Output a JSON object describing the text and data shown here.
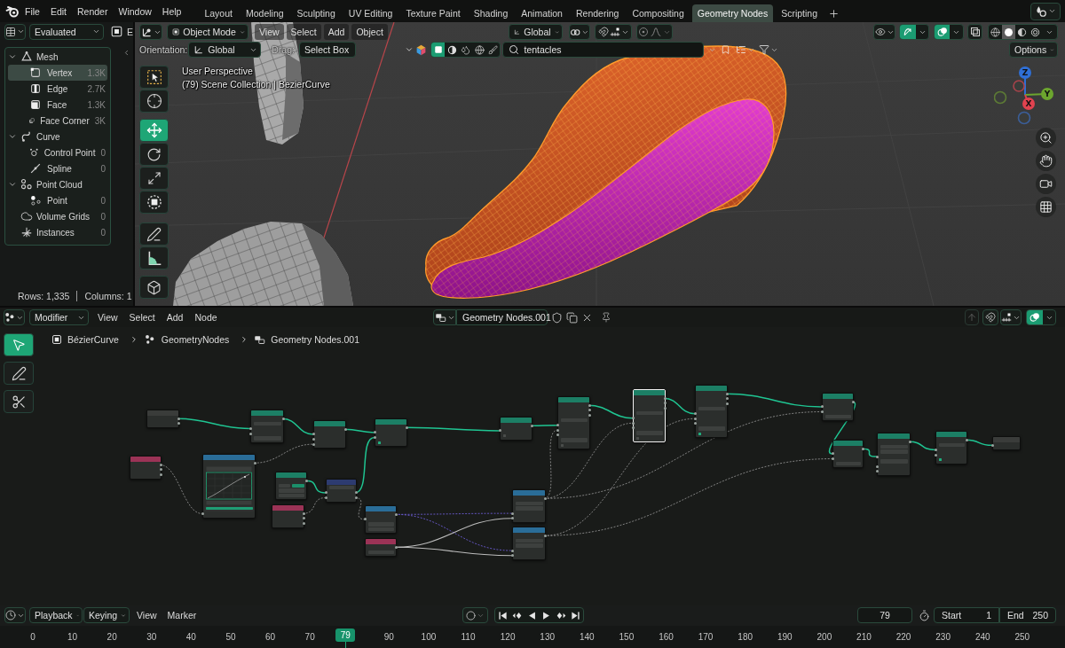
{
  "topbar": {
    "menus": [
      "File",
      "Edit",
      "Render",
      "Window",
      "Help"
    ],
    "workspaces": [
      {
        "label": "Layout",
        "selected": false
      },
      {
        "label": "Modeling",
        "selected": false
      },
      {
        "label": "Sculpting",
        "selected": false
      },
      {
        "label": "UV Editing",
        "selected": false
      },
      {
        "label": "Texture Paint",
        "selected": false
      },
      {
        "label": "Shading",
        "selected": false
      },
      {
        "label": "Animation",
        "selected": false
      },
      {
        "label": "Rendering",
        "selected": false
      },
      {
        "label": "Compositing",
        "selected": false
      },
      {
        "label": "Geometry Nodes",
        "selected": true
      },
      {
        "label": "Scripting",
        "selected": false
      }
    ]
  },
  "spreadsheet": {
    "evaluation": "Evaluated",
    "cut_label": "E",
    "tree": [
      {
        "label": "Mesh",
        "kind": "mesh",
        "expanded": true,
        "selected": false,
        "children": [
          {
            "label": "Vertex",
            "kind": "vertex",
            "count": "1.3K",
            "selected": true
          },
          {
            "label": "Edge",
            "kind": "edge",
            "count": "2.7K",
            "selected": false
          },
          {
            "label": "Face",
            "kind": "face",
            "count": "1.3K",
            "selected": false
          },
          {
            "label": "Face Corner",
            "kind": "corner",
            "count": "3K",
            "selected": false
          }
        ]
      },
      {
        "label": "Curve",
        "kind": "curve",
        "expanded": true,
        "selected": false,
        "children": [
          {
            "label": "Control Point",
            "kind": "control-point",
            "count": "0",
            "selected": false
          },
          {
            "label": "Spline",
            "kind": "spline",
            "count": "0",
            "selected": false
          }
        ]
      },
      {
        "label": "Point Cloud",
        "kind": "pointcloud",
        "expanded": true,
        "selected": false,
        "children": [
          {
            "label": "Point",
            "kind": "point",
            "count": "0",
            "selected": false
          }
        ]
      },
      {
        "label": "Volume Grids",
        "kind": "volume",
        "count": "0",
        "selected": false
      },
      {
        "label": "Instances",
        "kind": "instances",
        "count": "0",
        "selected": false
      }
    ],
    "rows": "Rows: 1,335",
    "columns": "Columns: 1"
  },
  "viewport": {
    "mode": "Object Mode",
    "menus": [
      "View",
      "Select",
      "Add",
      "Object"
    ],
    "transform_orientation": "Global",
    "gizmos_on": true,
    "overlays_on": true,
    "shading": [
      {
        "kind": "wireframe",
        "selected": false
      },
      {
        "kind": "solid",
        "selected": true
      },
      {
        "kind": "material",
        "selected": false
      },
      {
        "kind": "rendered",
        "selected": false
      }
    ],
    "orientation_label": "Orientation:",
    "orientation": "Global",
    "drag_label": "Drag:",
    "drag": "Select Box",
    "filters": [
      {
        "kind": "square",
        "selected": true
      },
      {
        "kind": "halfdisc",
        "selected": false
      },
      {
        "kind": "drops",
        "selected": false
      },
      {
        "kind": "globe",
        "selected": false
      },
      {
        "kind": "brush",
        "selected": false
      }
    ],
    "search": {
      "value": "tentacles"
    },
    "options": "Options",
    "info": [
      "User Perspective",
      "(79) Scene Collection | BezierCurve"
    ],
    "tools": [
      {
        "kind": "select",
        "selected": false
      },
      {
        "kind": "cursor",
        "selected": false
      },
      {
        "kind": "move",
        "selected": true
      },
      {
        "kind": "rotate",
        "selected": false
      },
      {
        "kind": "scale",
        "selected": false
      },
      {
        "kind": "transform",
        "selected": false
      },
      {
        "kind": "annotate",
        "selected": false
      },
      {
        "kind": "measure",
        "selected": false
      },
      {
        "kind": "add",
        "selected": false
      }
    ],
    "gizmo": [
      {
        "kind": "axis",
        "label": "Z",
        "color": "#2f6fd6"
      },
      {
        "kind": "axis",
        "label": "Y",
        "color": "#6ca52e"
      },
      {
        "kind": "axis",
        "label": "X",
        "color": "#e0424f"
      },
      {
        "kind": "negative",
        "color": "#5d7b35"
      },
      {
        "kind": "negative",
        "color": "#3b5e98"
      },
      {
        "kind": "negative",
        "color": "#a8434b"
      }
    ]
  },
  "node_editor": {
    "context": "Modifier",
    "menus": [
      "View",
      "Select",
      "Add",
      "Node"
    ],
    "tree_name": "Geometry Nodes.001",
    "overlays_on": true,
    "breadcrumbs": [
      {
        "kind": "object",
        "label": "BézierCurve"
      },
      {
        "kind": "modifier",
        "label": "GeometryNodes"
      },
      {
        "kind": "tree",
        "label": "Geometry Nodes.001"
      }
    ],
    "tools": [
      {
        "kind": "select",
        "selected": true
      },
      {
        "kind": "annotate",
        "selected": false
      },
      {
        "kind": "cut",
        "selected": false
      }
    ],
    "nodes": [
      {
        "kind": "group",
        "selected": false,
        "rows": [
          {
            "kind": "out"
          },
          {
            "kind": "out"
          }
        ]
      },
      {
        "kind": "geometry",
        "selected": false,
        "rows": [
          {
            "kind": "out"
          },
          {
            "kind": "field"
          },
          {
            "kind": "in"
          },
          {
            "kind": "in"
          },
          {
            "kind": "field"
          }
        ]
      },
      {
        "kind": "geometry",
        "selected": false,
        "rows": [
          {
            "kind": "out"
          },
          {
            "kind": "in"
          },
          {
            "kind": "in"
          },
          {
            "kind": "in"
          }
        ]
      },
      {
        "kind": "geometry",
        "selected": false,
        "rows": [
          {
            "kind": "out"
          },
          {
            "kind": "in"
          },
          {
            "kind": "in"
          },
          {
            "kind": "check",
            "checked": true
          }
        ]
      },
      {
        "kind": "geometry",
        "selected": false,
        "rows": [
          {
            "kind": "out"
          },
          {
            "kind": "in"
          },
          {
            "kind": "check",
            "checked": false
          }
        ]
      },
      {
        "kind": "geometry",
        "selected": false,
        "rows": [
          {
            "kind": "out"
          },
          {
            "kind": "out"
          },
          {
            "kind": "out"
          },
          {
            "kind": "field"
          },
          {
            "kind": "in"
          },
          {
            "kind": "in"
          },
          {
            "kind": "in"
          },
          {
            "kind": "field"
          },
          {
            "kind": "check",
            "checked": false
          }
        ]
      },
      {
        "kind": "geometry",
        "selected": true,
        "rows": [
          {
            "kind": "out"
          },
          {
            "kind": "out"
          },
          {
            "kind": "out"
          },
          {
            "kind": "field"
          },
          {
            "kind": "in"
          },
          {
            "kind": "in"
          },
          {
            "kind": "in"
          },
          {
            "kind": "field"
          },
          {
            "kind": "check",
            "checked": false
          }
        ]
      },
      {
        "kind": "geometry",
        "selected": false,
        "rows": [
          {
            "kind": "out"
          },
          {
            "kind": "out"
          },
          {
            "kind": "out"
          },
          {
            "kind": "field"
          },
          {
            "kind": "in"
          },
          {
            "kind": "in"
          },
          {
            "kind": "in"
          },
          {
            "kind": "field"
          },
          {
            "kind": "check",
            "checked": true
          }
        ]
      },
      {
        "kind": "geometry",
        "selected": false,
        "rows": [
          {
            "kind": "out"
          },
          {
            "kind": "in"
          },
          {
            "kind": "in"
          },
          {
            "kind": "field"
          }
        ]
      },
      {
        "kind": "geometry",
        "selected": false,
        "rows": [
          {
            "kind": "out"
          },
          {
            "kind": "in"
          },
          {
            "kind": "in"
          },
          {
            "kind": "field"
          }
        ]
      },
      {
        "kind": "geometry",
        "selected": false,
        "rows": [
          {
            "kind": "out"
          },
          {
            "kind": "field"
          },
          {
            "kind": "field"
          },
          {
            "kind": "in"
          },
          {
            "kind": "field"
          },
          {
            "kind": "in"
          },
          {
            "kind": "in"
          }
        ]
      },
      {
        "kind": "geometry",
        "selected": false,
        "rows": [
          {
            "kind": "out"
          },
          {
            "kind": "field"
          },
          {
            "kind": "in"
          },
          {
            "kind": "in"
          },
          {
            "kind": "check",
            "checked": true
          }
        ]
      },
      {
        "kind": "group",
        "selected": false,
        "rows": [
          {
            "kind": "in"
          }
        ]
      },
      {
        "kind": "input",
        "selected": false,
        "rows": [
          {
            "kind": "out"
          },
          {
            "kind": "out"
          },
          {
            "kind": "out"
          }
        ]
      },
      {
        "kind": "utility",
        "selected": false,
        "rows": [
          {
            "kind": "out"
          },
          {
            "kind": "curve"
          },
          {
            "kind": "slider",
            "level": 1
          },
          {
            "kind": "in"
          }
        ]
      },
      {
        "kind": "geometry",
        "selected": false,
        "rows": [
          {
            "kind": "out"
          },
          {
            "kind": "toggle",
            "options": [
              {
                "selected": false
              },
              {
                "selected": true
              }
            ]
          },
          {
            "kind": "field"
          },
          {
            "kind": "field"
          }
        ]
      },
      {
        "kind": "input",
        "selected": false,
        "rows": [
          {
            "kind": "out"
          },
          {
            "kind": "out"
          },
          {
            "kind": "out"
          }
        ]
      },
      {
        "kind": "attribute",
        "selected": false,
        "rows": [
          {
            "kind": "field"
          },
          {
            "kind": "both"
          },
          {
            "kind": "both"
          }
        ]
      },
      {
        "kind": "utility",
        "selected": false,
        "rows": [
          {
            "kind": "out"
          },
          {
            "kind": "in"
          },
          {
            "kind": "field"
          },
          {
            "kind": "field"
          }
        ]
      },
      {
        "kind": "input",
        "selected": false,
        "rows": [
          {
            "kind": "out"
          },
          {
            "kind": "field"
          }
        ]
      },
      {
        "kind": "utility",
        "selected": false,
        "rows": [
          {
            "kind": "out"
          },
          {
            "kind": "field"
          },
          {
            "kind": "field"
          },
          {
            "kind": "in"
          },
          {
            "kind": "in"
          }
        ]
      },
      {
        "kind": "utility",
        "selected": false,
        "rows": [
          {
            "kind": "out"
          },
          {
            "kind": "field"
          },
          {
            "kind": "field"
          },
          {
            "kind": "in"
          },
          {
            "kind": "in"
          }
        ]
      }
    ]
  },
  "timeline": {
    "playback": "Playback",
    "keying": "Keying",
    "menus": [
      "View",
      "Marker"
    ],
    "controls": [
      {
        "kind": "jump-start"
      },
      {
        "kind": "prev-key"
      },
      {
        "kind": "reverse"
      },
      {
        "kind": "play"
      },
      {
        "kind": "next-key"
      },
      {
        "kind": "jump-end"
      }
    ],
    "frame": "79",
    "start_label": "Start",
    "start": "1",
    "end_label": "End",
    "end": "250",
    "ruler": [
      "0",
      "10",
      "20",
      "30",
      "40",
      "50",
      "60",
      "70",
      "90",
      "100",
      "110",
      "120",
      "130",
      "140",
      "150",
      "160",
      "170",
      "180",
      "190",
      "200",
      "210",
      "220",
      "230",
      "240",
      "250"
    ],
    "playhead": {
      "label": "79",
      "level": 0.316
    }
  }
}
